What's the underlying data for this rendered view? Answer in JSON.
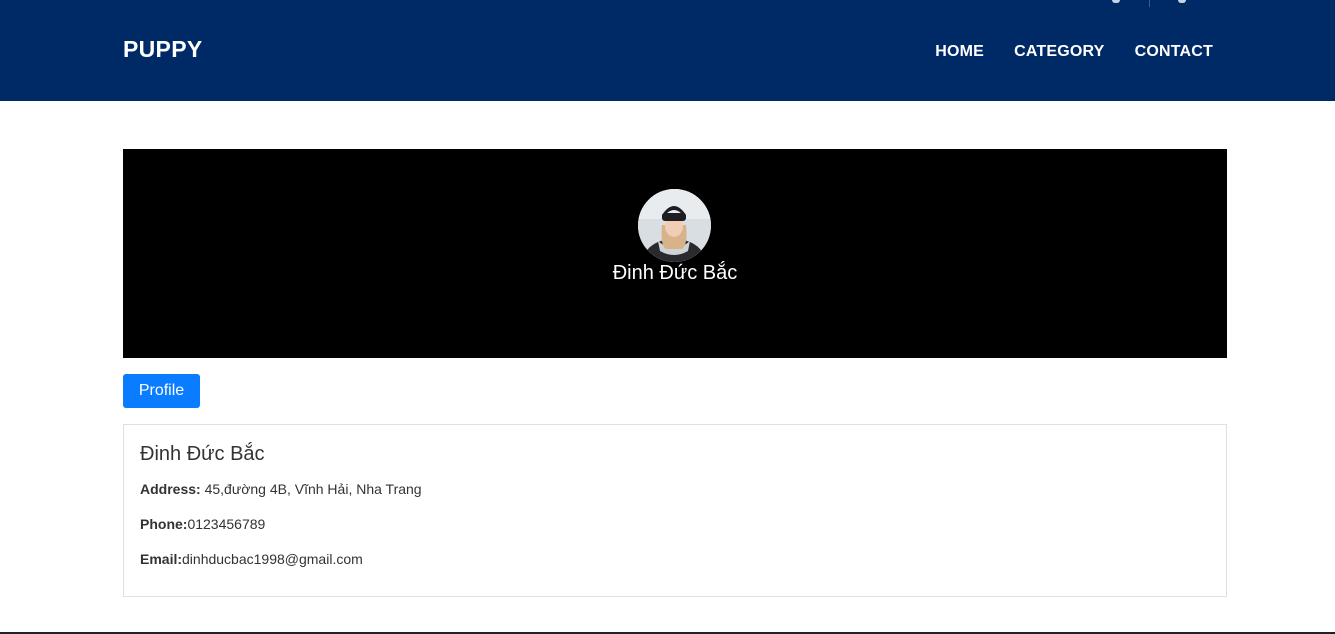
{
  "brand": "PUPPY",
  "nav": {
    "home": "HOME",
    "category": "CATEGORY",
    "contact": "CONTACT"
  },
  "hero": {
    "name": "Đinh Đức Bắc"
  },
  "tabs": {
    "profile": "Profile"
  },
  "profile": {
    "name": "Đinh Đức Bắc",
    "address_label": "Address:",
    "address_value": " 45,đường 4B, Vĩnh Hải, Nha Trang",
    "phone_label": "Phone:",
    "phone_value": "0123456789",
    "email_label": "Email:",
    "email_value": "dinhducbac1998@gmail.com"
  },
  "colors": {
    "header_bg": "#002a66",
    "hero_bg": "#000000",
    "button_bg": "#0a7cff"
  }
}
